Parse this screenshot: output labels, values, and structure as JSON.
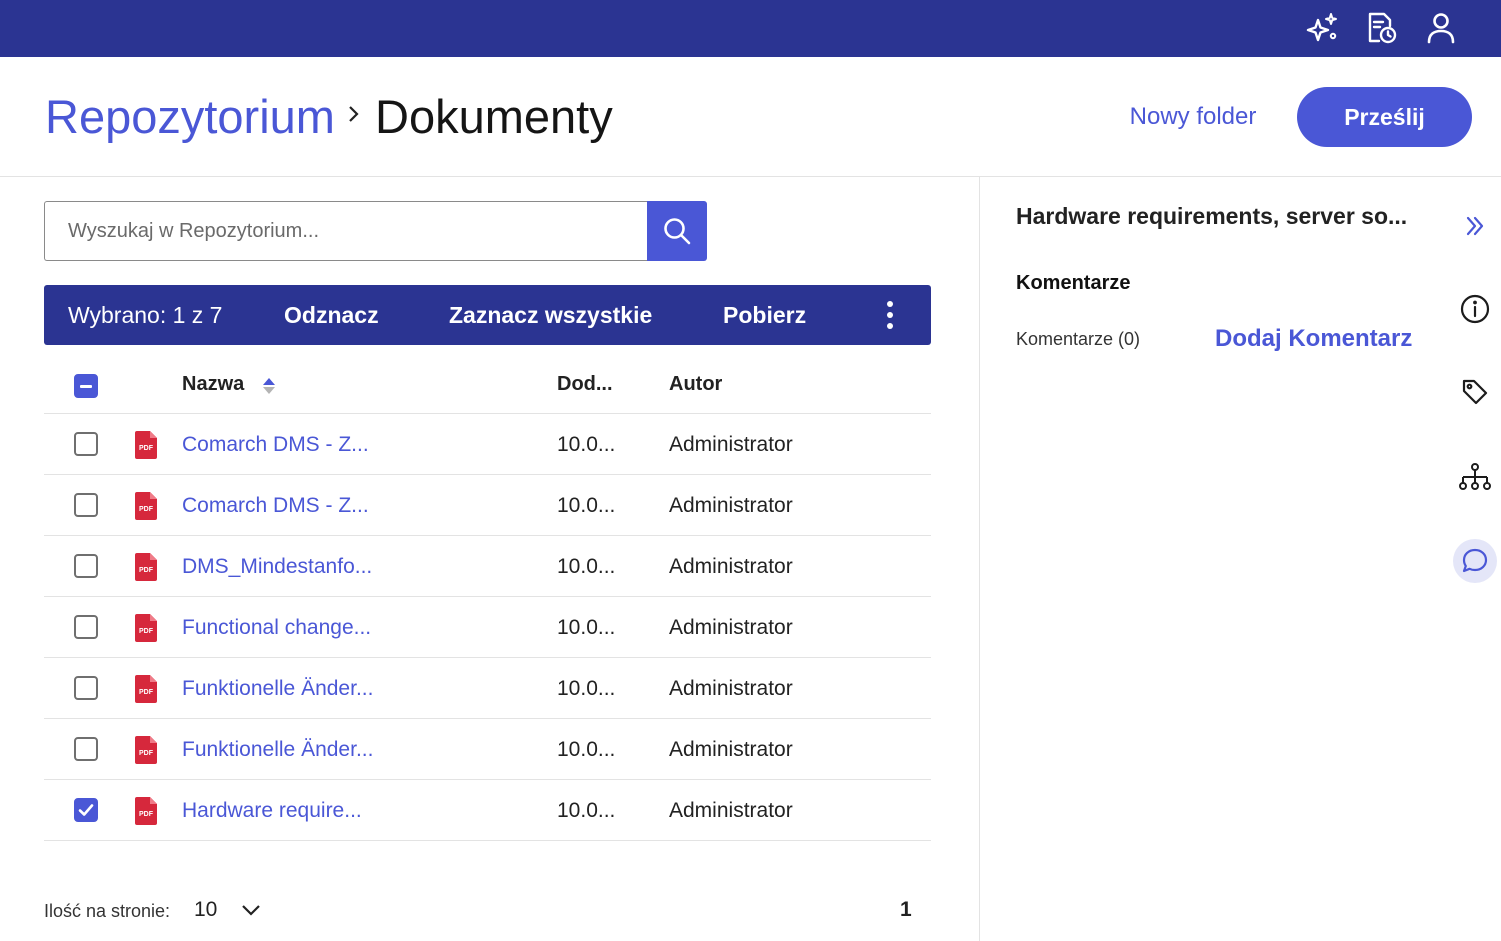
{
  "topbar": {
    "icons": [
      "sparkles-icon",
      "document-clock-icon",
      "user-icon"
    ]
  },
  "breadcrumb": {
    "root": "Repozytorium",
    "current": "Dokumenty"
  },
  "actions": {
    "new_folder": "Nowy folder",
    "upload": "Prześlij"
  },
  "search": {
    "placeholder": "Wyszukaj w Repozytorium..."
  },
  "selection_bar": {
    "count": "Wybrano: 1 z 7",
    "deselect": "Odznacz",
    "select_all": "Zaznacz wszystkie",
    "download": "Pobierz"
  },
  "table": {
    "columns": {
      "name": "Nazwa",
      "added": "Dod...",
      "author": "Autor"
    },
    "rows": [
      {
        "name": "Comarch DMS - Z...",
        "added": "10.0...",
        "author": "Administrator",
        "checked": false,
        "type": "PDF"
      },
      {
        "name": "Comarch DMS - Z...",
        "added": "10.0...",
        "author": "Administrator",
        "checked": false,
        "type": "PDF"
      },
      {
        "name": "DMS_Mindestanfo...",
        "added": "10.0...",
        "author": "Administrator",
        "checked": false,
        "type": "PDF"
      },
      {
        "name": "Functional change...",
        "added": "10.0...",
        "author": "Administrator",
        "checked": false,
        "type": "PDF"
      },
      {
        "name": "Funktionelle Änder...",
        "added": "10.0...",
        "author": "Administrator",
        "checked": false,
        "type": "PDF"
      },
      {
        "name": "Funktionelle Änder...",
        "added": "10.0...",
        "author": "Administrator",
        "checked": false,
        "type": "PDF"
      },
      {
        "name": "Hardware require...",
        "added": "10.0...",
        "author": "Administrator",
        "checked": true,
        "type": "PDF"
      }
    ]
  },
  "pagination": {
    "per_page_label": "Ilość na stronie:",
    "per_page_value": "10",
    "page": "1"
  },
  "details_panel": {
    "title": "Hardware requirements, server so...",
    "section": "Komentarze",
    "comments_count": "Komentarze (0)",
    "add_comment": "Dodaj Komentarz"
  },
  "side_icons": [
    "collapse-panel-icon",
    "info-icon",
    "tag-icon",
    "hierarchy-icon",
    "comment-icon"
  ],
  "colors": {
    "brand_dark": "#2b3492",
    "accent": "#4a57d6",
    "pdf_red": "#d6283c"
  }
}
